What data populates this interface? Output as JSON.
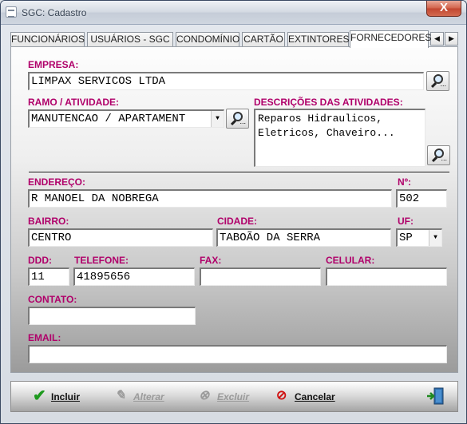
{
  "window": {
    "title": "SGC: Cadastro",
    "close_glyph": "X"
  },
  "tabs": [
    {
      "label": "FUNCIONÁRIOS"
    },
    {
      "label": "USUÁRIOS - SGC"
    },
    {
      "label": "CONDOMÍNIO"
    },
    {
      "label": "CARTÃO"
    },
    {
      "label": "EXTINTORES"
    },
    {
      "label": "FORNECEDORES",
      "active": true
    }
  ],
  "tab_scroll": {
    "left_glyph": "◀",
    "right_glyph": "▶"
  },
  "form": {
    "empresa": {
      "label": "EMPRESA:",
      "value": "LIMPAX SERVICOS LTDA"
    },
    "ramo": {
      "label": "RAMO / ATIVIDADE:",
      "value": "MANUTENCAO / APARTAMENT"
    },
    "descricoes": {
      "label": "DESCRIÇÕES DAS ATIVIDADES:",
      "value": "Reparos Hidraulicos,\nEletricos, Chaveiro..."
    },
    "endereco": {
      "label": "ENDEREÇO:",
      "value": "R MANOEL DA NOBREGA"
    },
    "numero": {
      "label": "Nº:",
      "value": "502"
    },
    "bairro": {
      "label": "BAIRRO:",
      "value": "CENTRO"
    },
    "cidade": {
      "label": "CIDADE:",
      "value": "TABOÃO DA SERRA"
    },
    "uf": {
      "label": "UF:",
      "value": "SP"
    },
    "ddd": {
      "label": "DDD:",
      "value": "11"
    },
    "telefone": {
      "label": "TELEFONE:",
      "value": "41895656"
    },
    "fax": {
      "label": "FAX:",
      "value": ""
    },
    "celular": {
      "label": "CELULAR:",
      "value": ""
    },
    "contato": {
      "label": "CONTATO:",
      "value": ""
    },
    "email": {
      "label": "EMAIL:",
      "value": ""
    }
  },
  "search_button": {
    "dots": "..."
  },
  "combo_arrow": "▼",
  "footer": {
    "incluir": {
      "label": "Incluir",
      "icon": "checkmark-icon",
      "enabled": true
    },
    "alterar": {
      "label": "Alterar",
      "icon": "edit-icon",
      "enabled": false
    },
    "excluir": {
      "label": "Excluir",
      "icon": "delete-icon",
      "enabled": false
    },
    "cancelar": {
      "label": "Cancelar",
      "icon": "cancel-icon",
      "enabled": true
    },
    "exit": {
      "icon": "exit-door-icon"
    }
  },
  "colors": {
    "label": "#b0006a",
    "check_green": "#1f9a1f",
    "cancel_red": "#d01010"
  }
}
